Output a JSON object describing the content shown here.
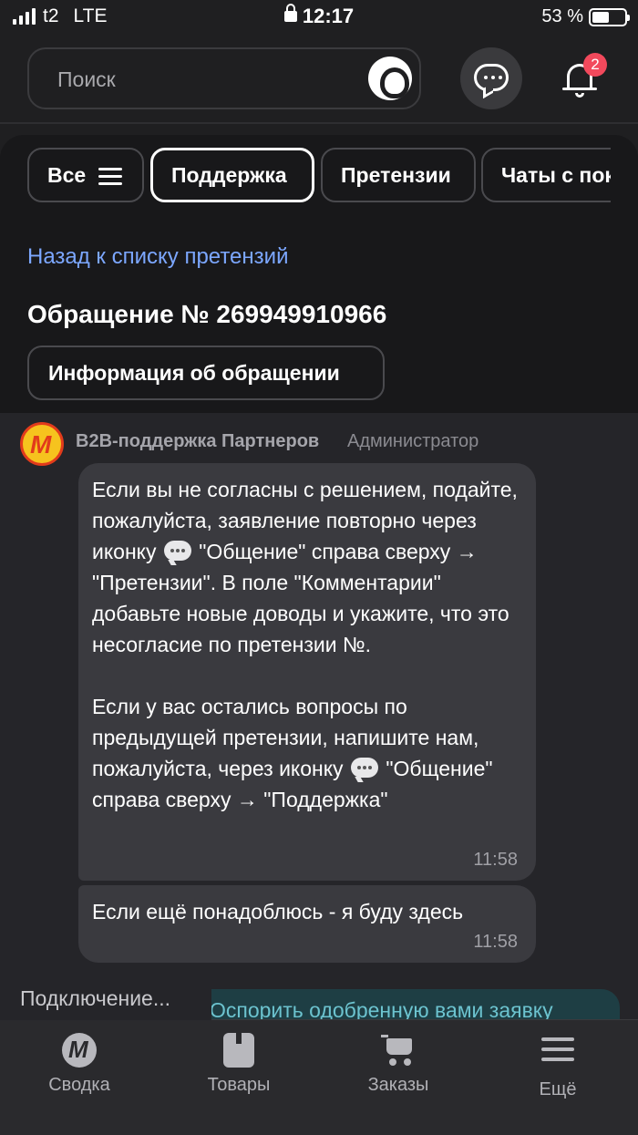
{
  "status_bar": {
    "carrier": "t2",
    "network": "LTE",
    "time": "12:17",
    "battery": "53 %",
    "battery_level": 0.53
  },
  "top_bar": {
    "search_placeholder": "Поиск",
    "notifications_count": "2",
    "icons": [
      "alice-voice-icon",
      "chat-icon",
      "bell-icon"
    ]
  },
  "tabs": [
    {
      "label": "Все",
      "active": false
    },
    {
      "label": "Поддержка",
      "active": true
    },
    {
      "label": "Претензии",
      "active": false
    },
    {
      "label": "Чаты с пок",
      "active": false
    }
  ],
  "ticket": {
    "back_link": "Назад к списку претензий",
    "title": "Обращение № 269949910966",
    "info_button": "Информация об обращении"
  },
  "chat": {
    "sender_name": "B2B-поддержка Партнеров",
    "sender_role": "Администратор",
    "messages": [
      {
        "p1_a": "Если вы не согласны с решением, подайте, пожалуйста, заявление повторно через иконку",
        "p1_b": "\"Общение\" справа сверху → \"Претензии\". В поле \"Комментарии\" добавьте новые доводы и укажите, что это несогласие по претензии №.",
        "p2_a": "Если у вас остались вопросы по предыдущей претензии, напишите нам, пожалуйста, через иконку",
        "p2_b": "\"Общение\" справа сверху → \"Поддержка\"",
        "time": "11:58"
      },
      {
        "text": "Если ещё понадоблюсь - я буду здесь",
        "time": "11:58"
      }
    ],
    "connecting": "Подключение...",
    "quick_reply": "Оспорить одобренную вами заявку"
  },
  "bottom_nav": [
    {
      "label": "Сводка",
      "icon": "summary-icon"
    },
    {
      "label": "Товары",
      "icon": "goods-icon"
    },
    {
      "label": "Заказы",
      "icon": "cart-icon"
    },
    {
      "label": "Ещё",
      "icon": "menu-icon"
    }
  ],
  "colors": {
    "background": "#1f1f21",
    "link": "#7ca7ff",
    "badge": "#f2495c",
    "bubble": "#3a3a3f"
  }
}
